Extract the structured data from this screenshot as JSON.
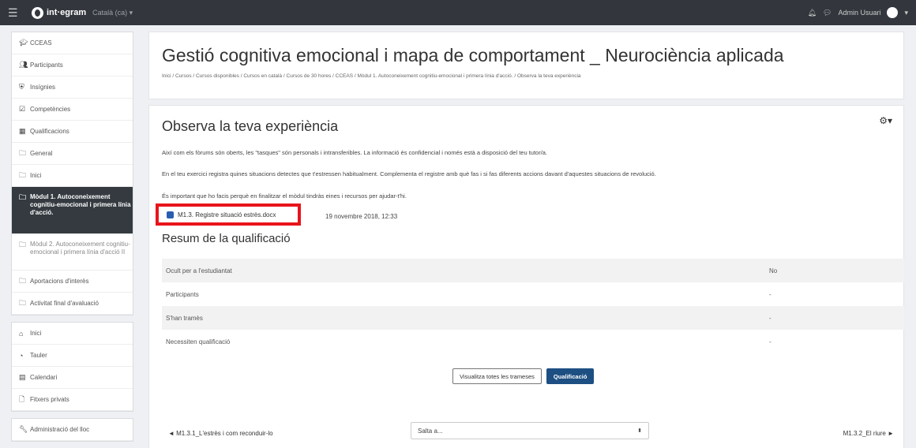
{
  "navbar": {
    "brand": "int·egram",
    "language": "Català (ca) ▾",
    "user": "Admin Usuari"
  },
  "sidebar": {
    "course": [
      {
        "label": "CCEAS",
        "icon": "graduation-cap-icon"
      },
      {
        "label": "Participants",
        "icon": "users-icon"
      },
      {
        "label": "Insígnies",
        "icon": "shield-icon"
      },
      {
        "label": "Competències",
        "icon": "check-square-icon"
      },
      {
        "label": "Qualificacions",
        "icon": "table-icon"
      },
      {
        "label": "General",
        "icon": "folder-icon"
      },
      {
        "label": "Inici",
        "icon": "folder-icon"
      },
      {
        "label": "Mòdul 1. Autoconeixement cognitiu-emocional i primera línia d'acció.",
        "icon": "folder-icon"
      },
      {
        "label": "Mòdul 2. Autoconeixement cognitiu-emocional i primera línia d'acció II",
        "icon": "folder-icon"
      },
      {
        "label": "Aportacions d'interès",
        "icon": "folder-icon"
      },
      {
        "label": "Activitat final d'avaluació",
        "icon": "folder-icon"
      }
    ],
    "site": [
      {
        "label": "Inici",
        "icon": "home-icon"
      },
      {
        "label": "Tauler",
        "icon": "dashboard-icon"
      },
      {
        "label": "Calendari",
        "icon": "calendar-icon"
      },
      {
        "label": "Fitxers privats",
        "icon": "file-icon"
      }
    ],
    "admin": {
      "label": "Administració del lloc",
      "icon": "wrench-icon"
    }
  },
  "header": {
    "title": "Gestió cognitiva emocional i mapa de comportament _ Neurociència aplicada",
    "breadcrumb": "Inici / Cursos / Cursos disponibles / Cursos en català / Cursos de 30 hores / CCEAS / Mòdul 1. Autoconeixement cognitiu-emocional i primera línia d'acció. / Observa la teva experiència"
  },
  "activity": {
    "title": "Observa la teva experiència",
    "p1": "Així com els fòrums són oberts, les \"tasques\" són personals i intransferibles. La informació és confidencial i només està a disposició del teu tutor/a.",
    "p2": "En el teu exercici registra quines situacions detectes que t'estressen habitualment. Complementa el registre amb què fas i si fas diferents accions davant d'aquestes situacions de revolució.",
    "p3": "És important que ho facis perquè en finalitzar el mòdul tindràs eines i recursos per ajudar-t'hi.",
    "file": {
      "name": "M1.3. Registre situació estrès.docx",
      "date": "19 novembre 2018, 12:33"
    }
  },
  "summary": {
    "title": "Resum de la qualificació",
    "rows": [
      {
        "label": "Ocult per a l'estudiantat",
        "value": "No"
      },
      {
        "label": "Participants",
        "value": "-"
      },
      {
        "label": "S'han tramès",
        "value": "-"
      },
      {
        "label": "Necessiten qualificació",
        "value": "-"
      }
    ],
    "view_all": "Visualitza totes les trameses",
    "grade": "Qualificació"
  },
  "footer_nav": {
    "prev": "◄ M1.3.1_L'estrès i com reconduir-lo",
    "jump": "Salta a...",
    "next": "M1.3.2_El riure ►"
  }
}
